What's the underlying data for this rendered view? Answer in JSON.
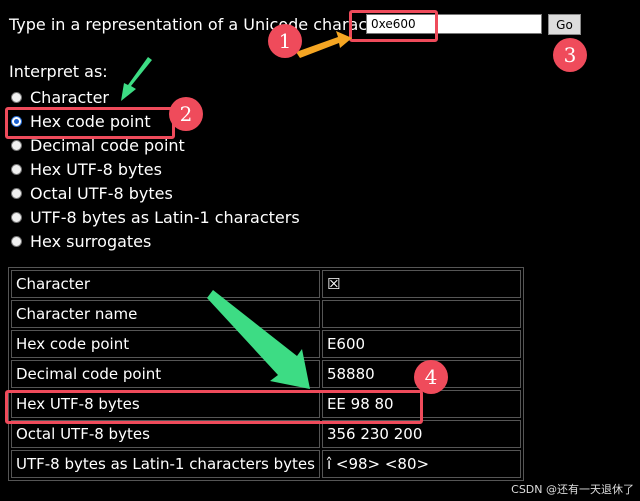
{
  "form": {
    "prompt_label": "Type in a representation of a Unicode character:",
    "input_value": "0xe600",
    "go_label": "Go"
  },
  "interpret": {
    "heading": "Interpret as:",
    "options": [
      {
        "label": "Character",
        "checked": false
      },
      {
        "label": "Hex code point",
        "checked": true
      },
      {
        "label": "Decimal code point",
        "checked": false
      },
      {
        "label": "Hex UTF-8 bytes",
        "checked": false
      },
      {
        "label": "Octal UTF-8 bytes",
        "checked": false
      },
      {
        "label": "UTF-8 bytes as Latin-1 characters",
        "checked": false
      },
      {
        "label": "Hex surrogates",
        "checked": false
      }
    ]
  },
  "results": {
    "rows": [
      {
        "label": "Character",
        "value": "☒"
      },
      {
        "label": "Character name",
        "value": ""
      },
      {
        "label": "Hex code point",
        "value": "E600"
      },
      {
        "label": "Decimal code point",
        "value": "58880"
      },
      {
        "label": "Hex UTF-8 bytes",
        "value": "EE 98 80"
      },
      {
        "label": "Octal UTF-8 bytes",
        "value": "356 230 200"
      },
      {
        "label": "UTF-8 bytes as Latin-1 characters bytes",
        "value": "î <98> <80>"
      }
    ]
  },
  "annotations": {
    "badges": [
      "1",
      "2",
      "3",
      "4"
    ],
    "box_color": "#ef4b5b",
    "arrow_yellow": "#f5a623",
    "arrow_green": "#3ddc84"
  },
  "watermark": "CSDN @还有一天退休了"
}
